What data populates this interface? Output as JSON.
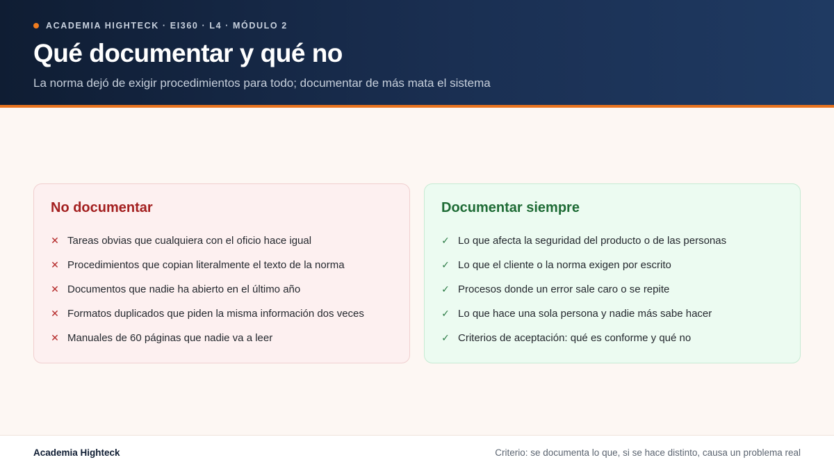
{
  "header": {
    "eyebrow": "ACADEMIA HIGHTECK · EI360 · L4 · MÓDULO 2",
    "title": "Qué documentar y qué no",
    "subtitle": "La norma dejó de exigir procedimientos para todo; documentar de más mata el sistema"
  },
  "no_card": {
    "heading": "No documentar",
    "mark": "✕",
    "icon": "cross-icon",
    "items": [
      "Tareas obvias que cualquiera con el oficio hace igual",
      "Procedimientos que copian literalmente el texto de la norma",
      "Documentos que nadie ha abierto en el último año",
      "Formatos duplicados que piden la misma información dos veces",
      "Manuales de 60 páginas que nadie va a leer"
    ]
  },
  "yes_card": {
    "heading": "Documentar siempre",
    "mark": "✓",
    "icon": "check-icon",
    "items": [
      "Lo que afecta la seguridad del producto o de las personas",
      "Lo que el cliente o la norma exigen por escrito",
      "Procesos donde un error sale caro o se repite",
      "Lo que hace una sola persona y nadie más sabe hacer",
      "Criterios de aceptación: qué es conforme y qué no"
    ]
  },
  "footer": {
    "brand": "Academia Highteck",
    "note": "Criterio: se documenta lo que, si se hace distinto, causa un problema real"
  },
  "colors": {
    "header_bg": "#0f1d33",
    "accent": "#e8731e",
    "no_heading": "#a31f1f",
    "yes_heading": "#1e6b35"
  }
}
